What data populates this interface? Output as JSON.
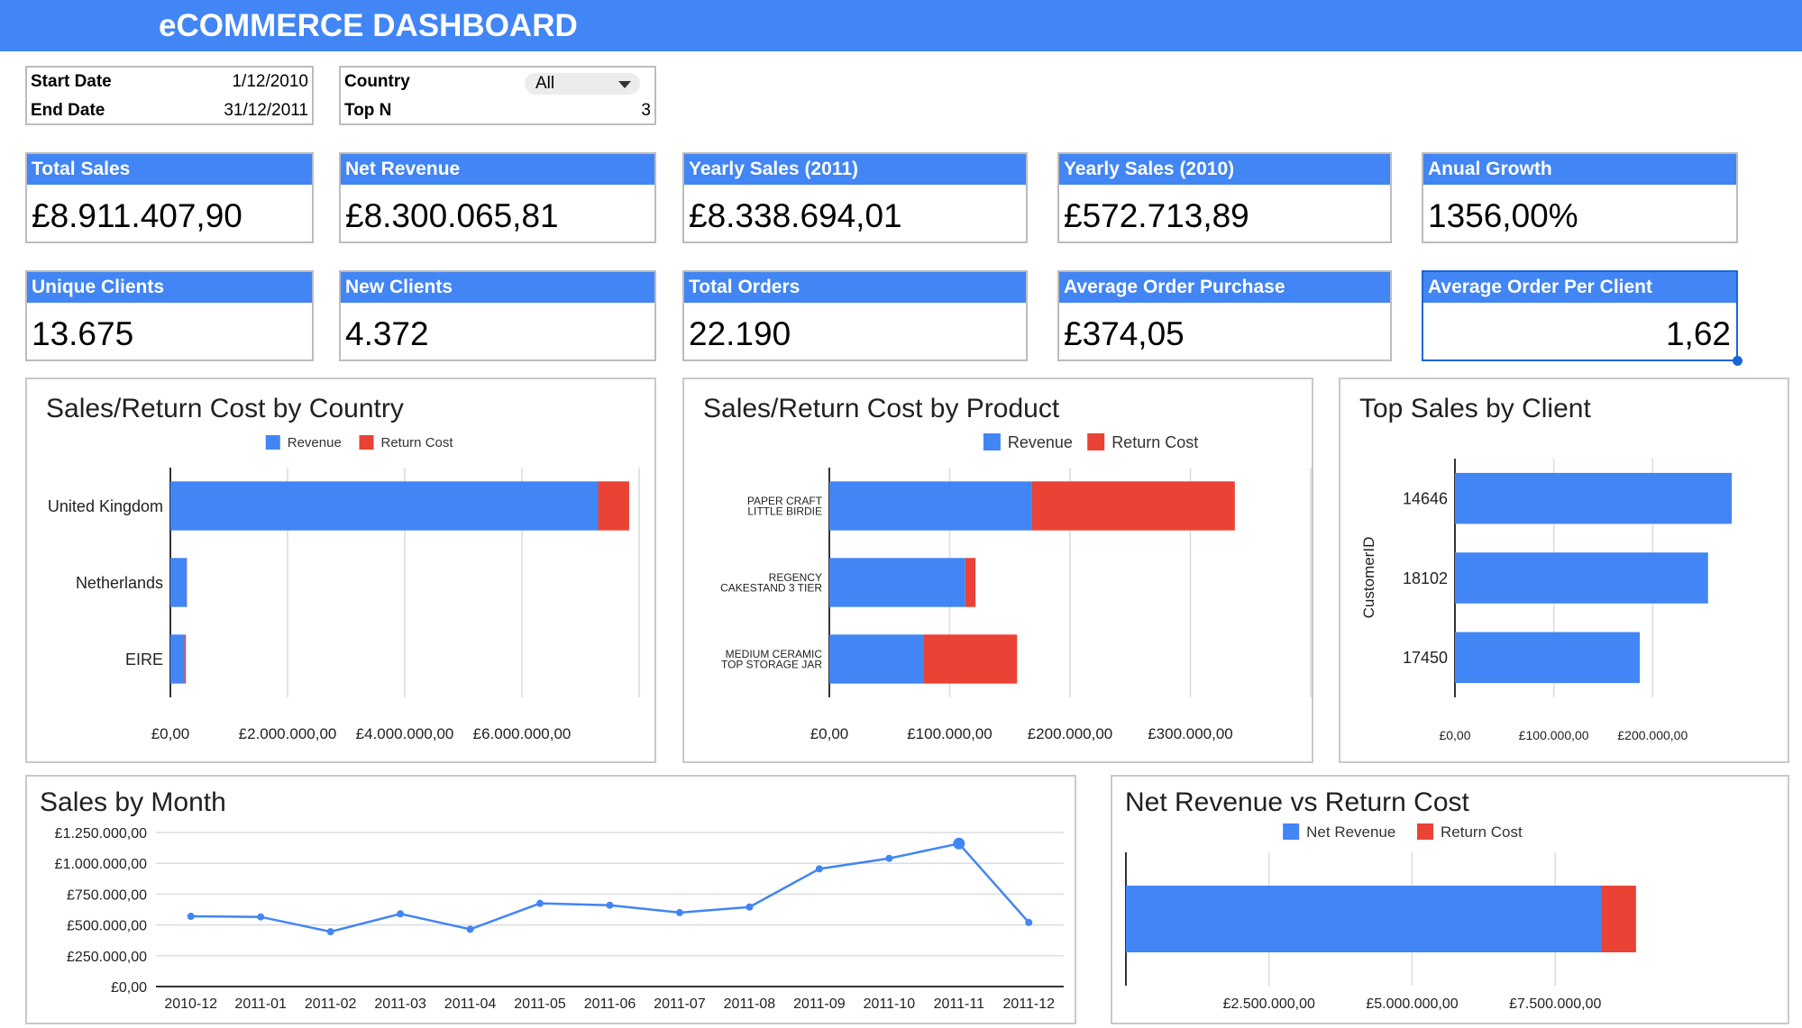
{
  "header": {
    "title": "eCOMMERCE DASHBOARD"
  },
  "filters": {
    "start_date_label": "Start Date",
    "start_date": "1/12/2010",
    "end_date_label": "End Date",
    "end_date": "31/12/2011",
    "country_label": "Country",
    "country_value": "All",
    "topn_label": "Top N",
    "topn_value": "3"
  },
  "kpis": [
    {
      "label": "Total Sales",
      "value": "£8.911.407,90"
    },
    {
      "label": "Net Revenue",
      "value": "£8.300.065,81"
    },
    {
      "label": "Yearly Sales (2011)",
      "value": "£8.338.694,01"
    },
    {
      "label": "Yearly Sales (2010)",
      "value": "£572.713,89"
    },
    {
      "label": "Anual Growth",
      "value": "1356,00%"
    },
    {
      "label": "Unique Clients",
      "value": "13.675"
    },
    {
      "label": "New Clients",
      "value": "4.372"
    },
    {
      "label": "Total Orders",
      "value": "22.190"
    },
    {
      "label": "Average Order Purchase",
      "value": "£374,05"
    },
    {
      "label": "Average Order Per Client",
      "value": "1,62"
    }
  ],
  "colors": {
    "revenue": "#4285f4",
    "return_cost": "#ea4335",
    "header": "#4285f4",
    "grid": "#dcdcdc"
  },
  "chart_data": [
    {
      "id": "country",
      "type": "bar",
      "orientation": "horizontal",
      "stacked": true,
      "title": "Sales/Return Cost by Country",
      "categories": [
        "United Kingdom",
        "Netherlands",
        "EIRE"
      ],
      "series": [
        {
          "name": "Revenue",
          "values": [
            7300000,
            280000,
            240000
          ]
        },
        {
          "name": "Return Cost",
          "values": [
            530000,
            5000,
            25000
          ]
        }
      ],
      "xlim": [
        0,
        8000000
      ],
      "xticks": [
        0,
        2000000,
        4000000,
        6000000
      ],
      "xtick_labels": [
        "£0,00",
        "£2.000.000,00",
        "£4.000.000,00",
        "£6.000.000,00"
      ],
      "legend": "top",
      "grid": true
    },
    {
      "id": "product",
      "type": "bar",
      "orientation": "horizontal",
      "stacked": true,
      "title": "Sales/Return Cost by Product",
      "categories": [
        "PAPER CRAFT\nLITTLE BIRDIE",
        "REGENCY\nCAKESTAND 3 TIER",
        "MEDIUM CERAMIC\nTOP STORAGE JAR"
      ],
      "series": [
        {
          "name": "Revenue",
          "values": [
            168470,
            113000,
            78000
          ]
        },
        {
          "name": "Return Cost",
          "values": [
            168470,
            8500,
            78000
          ]
        }
      ],
      "xlim": [
        0,
        400000
      ],
      "xticks": [
        0,
        100000,
        200000,
        300000
      ],
      "xtick_labels": [
        "£0,00",
        "£100.000,00",
        "£200.000,00",
        "£300.000,00"
      ],
      "legend": "top",
      "grid": true
    },
    {
      "id": "client",
      "type": "bar",
      "orientation": "horizontal",
      "title": "Top Sales by Client",
      "ylabel": "CustomerID",
      "categories": [
        "14646",
        "18102",
        "17450"
      ],
      "series": [
        {
          "name": "",
          "values": [
            280000,
            256000,
            187000
          ]
        }
      ],
      "xlim": [
        0,
        300000
      ],
      "xticks": [
        0,
        100000,
        200000
      ],
      "xtick_labels": [
        "£0,00",
        "£100.000,00",
        "£200.000,00"
      ],
      "legend": "none",
      "grid": true
    },
    {
      "id": "month",
      "type": "line",
      "title": "Sales by Month",
      "x": [
        "2010-12",
        "2011-01",
        "2011-02",
        "2011-03",
        "2011-04",
        "2011-05",
        "2011-06",
        "2011-07",
        "2011-08",
        "2011-09",
        "2011-10",
        "2011-11",
        "2011-12"
      ],
      "series": [
        {
          "name": "",
          "values": [
            570000,
            565000,
            445000,
            590000,
            465000,
            675000,
            660000,
            600000,
            645000,
            955000,
            1040000,
            1160000,
            520000
          ]
        }
      ],
      "ylim": [
        0,
        1250000
      ],
      "yticks": [
        0,
        250000,
        500000,
        750000,
        1000000,
        1250000
      ],
      "ytick_labels": [
        "£0,00",
        "£250.000,00",
        "£500.000,00",
        "£750.000,00",
        "£1.000.000,00",
        "£1.250.000,00"
      ],
      "highlight_index": 11,
      "grid": true
    },
    {
      "id": "netrev",
      "type": "bar",
      "orientation": "horizontal",
      "stacked": true,
      "title": "Net Revenue vs Return Cost",
      "categories": [
        ""
      ],
      "series": [
        {
          "name": "Net Revenue",
          "values": [
            8300065.81
          ]
        },
        {
          "name": "Return Cost",
          "values": [
            611342.09
          ]
        }
      ],
      "xlim": [
        0,
        10000000
      ],
      "xticks": [
        2500000,
        5000000,
        7500000
      ],
      "xtick_labels": [
        "£2.500.000,00",
        "£5.000.000,00",
        "£7.500.000,00"
      ],
      "legend": "top",
      "grid": true
    }
  ]
}
